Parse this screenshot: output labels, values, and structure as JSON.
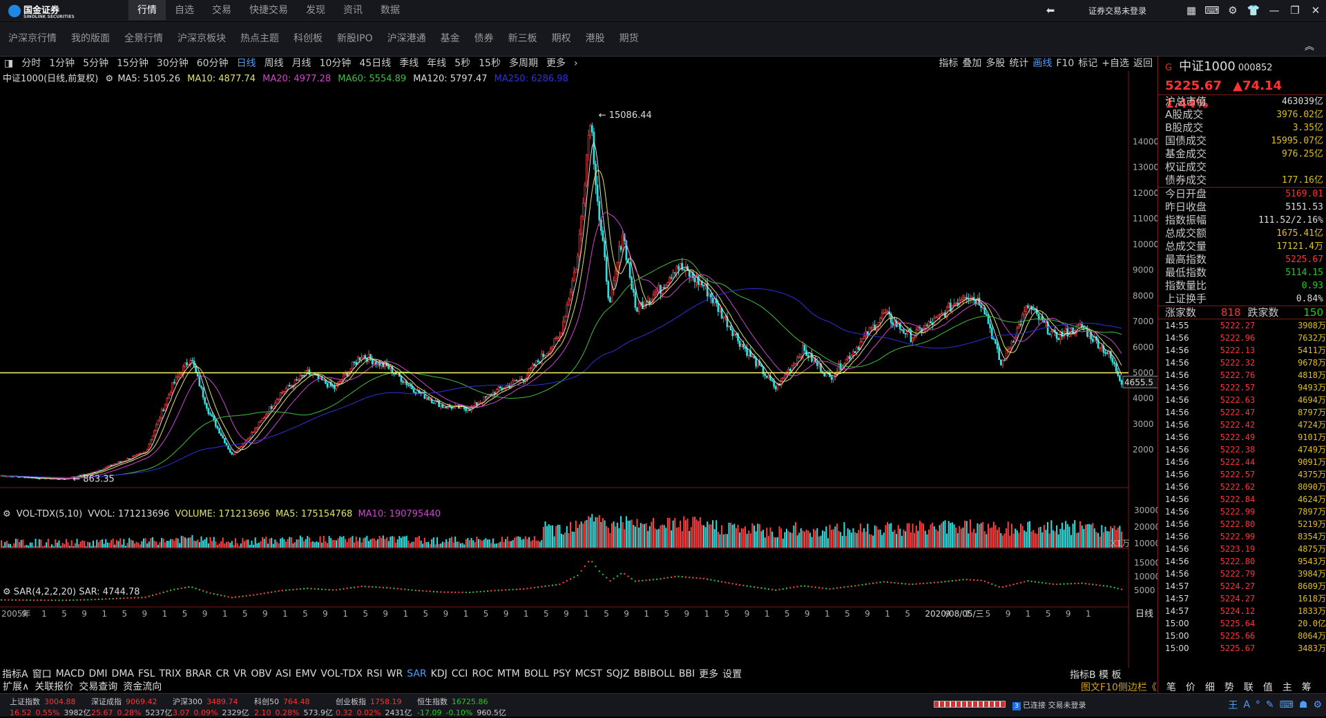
{
  "app": {
    "logo_text": "国金证券",
    "logo_sub": "SINOLINK SECURITIES"
  },
  "topnav": [
    "行情",
    "自选",
    "交易",
    "快捷交易",
    "发现",
    "资讯",
    "数据"
  ],
  "topnav_active": 0,
  "login_label": "证券交易未登录",
  "subnav": [
    "沪深京行情",
    "我的版面",
    "全景行情",
    "沪深京板块",
    "热点主题",
    "科创板",
    "新股IPO",
    "沪深港通",
    "基金",
    "债券",
    "新三板",
    "期权",
    "港股",
    "期货"
  ],
  "periods": [
    "分时",
    "1分钟",
    "5分钟",
    "15分钟",
    "30分钟",
    "60分钟",
    "日线",
    "周线",
    "月线",
    "10分钟",
    "45日线",
    "季线",
    "年线",
    "5秒",
    "15秒",
    "多周期",
    "更多"
  ],
  "period_active": "日线",
  "tools": [
    "指标",
    "叠加",
    "多股",
    "统计",
    "画线",
    "F10",
    "标记",
    "+自选",
    "返回"
  ],
  "tool_active": "画线",
  "legend": {
    "title": "中证1000(日线,前复权)",
    "ma5": "MA5: 5105.26",
    "ma10": "MA10: 4877.74",
    "ma20": "MA20: 4977.28",
    "ma60": "MA60: 5554.89",
    "ma120": "MA120: 5797.47",
    "ma250": "MA250: 6286.98"
  },
  "vol_legend": {
    "name": "VOL-TDX(5,10)",
    "vvol": "VVOL: 171213696",
    "volume": "VOLUME: 171213696",
    "ma5": "MA5: 175154768",
    "ma10": "MA10: 190795440"
  },
  "sar_legend": "SAR(4,2,2,20) SAR: 4744.78",
  "indicators": [
    "指标A",
    "窗口",
    "MACD",
    "DMI",
    "DMA",
    "FSL",
    "TRIX",
    "BRAR",
    "CR",
    "VR",
    "OBV",
    "ASI",
    "EMV",
    "VOL-TDX",
    "RSI",
    "WR",
    "SAR",
    "KDJ",
    "CCI",
    "ROC",
    "MTM",
    "BOLL",
    "PSY",
    "MCST",
    "SQJZ",
    "BBIBOLL",
    "BBI",
    "更多",
    "设置"
  ],
  "indicator_active": "SAR",
  "ext": [
    "扩展∧",
    "关联报价",
    "交易查询",
    "资金流向"
  ],
  "chart_right": "指标B 模 板",
  "f10_label": "图文F10侧边栏《",
  "right_tabs": [
    "笔",
    "价",
    "细",
    "势",
    "联",
    "值",
    "主",
    "筹"
  ],
  "quote": {
    "flag": "G",
    "name": "中证1000",
    "code": "000852",
    "price": "5225.67",
    "change": "▲74.14",
    "pct": "1.44%"
  },
  "stats1": [
    {
      "k": "沪总市值",
      "v": "463039亿",
      "c": "vw"
    },
    {
      "k": "A股成交",
      "v": "3976.02亿",
      "c": "vy"
    },
    {
      "k": "B股成交",
      "v": "3.35亿",
      "c": "vy"
    },
    {
      "k": "国债成交",
      "v": "15995.07亿",
      "c": "vy"
    },
    {
      "k": "基金成交",
      "v": "976.25亿",
      "c": "vy"
    },
    {
      "k": "权证成交",
      "v": "",
      "c": "vy"
    },
    {
      "k": "债券成交",
      "v": "177.16亿",
      "c": "vy"
    }
  ],
  "stats2": [
    {
      "k": "今日开盘",
      "v": "5169.01",
      "c": "vr"
    },
    {
      "k": "昨日收盘",
      "v": "5151.53",
      "c": "vw"
    },
    {
      "k": "指数振幅",
      "v": "111.52/2.16%",
      "c": "vw"
    },
    {
      "k": "总成交额",
      "v": "1675.41亿",
      "c": "vy"
    },
    {
      "k": "总成交量",
      "v": "17121.4万",
      "c": "vy"
    },
    {
      "k": "最高指数",
      "v": "5225.67",
      "c": "vr"
    },
    {
      "k": "最低指数",
      "v": "5114.15",
      "c": "vgr"
    },
    {
      "k": "指数量比",
      "v": "0.93",
      "c": "vgr"
    },
    {
      "k": "上证换手",
      "v": "0.84%",
      "c": "vw"
    }
  ],
  "updown": {
    "up_label": "涨家数",
    "up": "818",
    "down_label": "跌家数",
    "down": "150"
  },
  "ticks": [
    [
      "14:55",
      "5222.27",
      "3908万"
    ],
    [
      "14:56",
      "5222.96",
      "7632万"
    ],
    [
      "14:56",
      "5222.13",
      "5411万"
    ],
    [
      "14:56",
      "5222.32",
      "9678万"
    ],
    [
      "14:56",
      "5222.76",
      "4818万"
    ],
    [
      "14:56",
      "5222.57",
      "9493万"
    ],
    [
      "14:56",
      "5222.63",
      "4694万"
    ],
    [
      "14:56",
      "5222.47",
      "8797万"
    ],
    [
      "14:56",
      "5222.42",
      "4724万"
    ],
    [
      "14:56",
      "5222.49",
      "9101万"
    ],
    [
      "14:56",
      "5222.38",
      "4749万"
    ],
    [
      "14:56",
      "5222.44",
      "9091万"
    ],
    [
      "14:56",
      "5222.57",
      "4375万"
    ],
    [
      "14:56",
      "5222.62",
      "8090万"
    ],
    [
      "14:56",
      "5222.84",
      "4624万"
    ],
    [
      "14:56",
      "5222.99",
      "7897万"
    ],
    [
      "14:56",
      "5222.80",
      "5219万"
    ],
    [
      "14:56",
      "5222.99",
      "8354万"
    ],
    [
      "14:56",
      "5223.19",
      "4875万"
    ],
    [
      "14:56",
      "5222.80",
      "9543万"
    ],
    [
      "14:56",
      "5222.79",
      "3984万"
    ],
    [
      "14:57",
      "5224.27",
      "8609万"
    ],
    [
      "14:57",
      "5224.27",
      "1618万"
    ],
    [
      "14:57",
      "5224.12",
      "1833万"
    ],
    [
      "15:00",
      "5225.64",
      "20.0亿"
    ],
    [
      "15:00",
      "5225.66",
      "8064万"
    ],
    [
      "15:00",
      "5225.67",
      "3483万"
    ]
  ],
  "bottom_indices": [
    {
      "name": "上证指数",
      "price": "3004.88",
      "chg": "16.52",
      "pct": "0.55%",
      "amt": "3982亿",
      "down": false
    },
    {
      "name": "深证成指",
      "price": "9069.42",
      "chg": "25.67",
      "pct": "0.28%",
      "amt": "5237亿",
      "down": false
    },
    {
      "name": "沪深300",
      "price": "3489.74",
      "chg": "3.07",
      "pct": "0.09%",
      "amt": "2329亿",
      "down": false
    },
    {
      "name": "科创50",
      "price": "764.48",
      "chg": "2.10",
      "pct": "0.28%",
      "amt": "573.9亿",
      "down": false
    },
    {
      "name": "创业板指",
      "price": "1758.19",
      "chg": "0.32",
      "pct": "0.02%",
      "amt": "2431亿",
      "down": false
    },
    {
      "name": "恒生指数",
      "price": "16725.86",
      "chg": "-17.09",
      "pct": "-0.10%",
      "amt": "960.5亿",
      "down": true
    }
  ],
  "connection": {
    "badge": "3",
    "text": "已连接 交易未登录"
  },
  "tray_icons": [
    "王",
    "A",
    "°",
    "✎",
    "⌨",
    "☗",
    "⚙"
  ],
  "chart_data": {
    "type": "candlestick",
    "title": "中证1000(日线,前复权)",
    "y_axis_labels": [
      14000,
      13000,
      12000,
      11000,
      10000,
      9000,
      8000,
      7000,
      6000,
      5000,
      4000,
      3000,
      2000
    ],
    "ylim": [
      500,
      16000
    ],
    "annotations": {
      "high": "15086.44",
      "low": "863.35",
      "current": "4655.5",
      "hline": "5000"
    },
    "x_axis_labels": [
      "2005年",
      "9",
      "1",
      "5",
      "9",
      "1",
      "5",
      "9",
      "1",
      "5",
      "9",
      "1",
      "5",
      "9",
      "1",
      "5",
      "9",
      "1",
      "5",
      "9",
      "1",
      "5",
      "9",
      "1",
      "5",
      "9",
      "1",
      "5",
      "9",
      "1",
      "5",
      "9",
      "1",
      "5",
      "9",
      "1",
      "5",
      "9",
      "1",
      "5",
      "9",
      "1",
      "5",
      "9",
      "1",
      "5",
      "2020/08/05/三",
      "9",
      "1",
      "5",
      "9",
      "1",
      "5",
      "9",
      "1"
    ],
    "x_label_right": "日线",
    "price_path": [
      [
        0,
        1000
      ],
      [
        20,
        900
      ],
      [
        35,
        863
      ],
      [
        50,
        1100
      ],
      [
        80,
        1900
      ],
      [
        95,
        4500
      ],
      [
        105,
        5600
      ],
      [
        115,
        3500
      ],
      [
        128,
        1800
      ],
      [
        140,
        2700
      ],
      [
        155,
        4200
      ],
      [
        170,
        5000
      ],
      [
        185,
        4400
      ],
      [
        200,
        5700
      ],
      [
        215,
        5200
      ],
      [
        230,
        4300
      ],
      [
        245,
        3700
      ],
      [
        260,
        3600
      ],
      [
        275,
        4300
      ],
      [
        290,
        4800
      ],
      [
        310,
        6400
      ],
      [
        320,
        9500
      ],
      [
        327,
        15086
      ],
      [
        332,
        11000
      ],
      [
        338,
        7600
      ],
      [
        345,
        10500
      ],
      [
        352,
        7500
      ],
      [
        365,
        8200
      ],
      [
        375,
        9200
      ],
      [
        390,
        8400
      ],
      [
        410,
        6200
      ],
      [
        430,
        4400
      ],
      [
        445,
        5900
      ],
      [
        460,
        4800
      ],
      [
        475,
        6000
      ],
      [
        490,
        7300
      ],
      [
        505,
        6400
      ],
      [
        520,
        7100
      ],
      [
        535,
        8100
      ],
      [
        545,
        7700
      ],
      [
        555,
        5300
      ],
      [
        570,
        7600
      ],
      [
        585,
        6400
      ],
      [
        600,
        6800
      ],
      [
        615,
        5700
      ],
      [
        622,
        4655
      ]
    ],
    "volume_ylabels": [
      "30000",
      "20000",
      "10000"
    ],
    "volume_unit": "X1万",
    "sar_ylabels": [
      "15000",
      "10000",
      "5000"
    ]
  }
}
